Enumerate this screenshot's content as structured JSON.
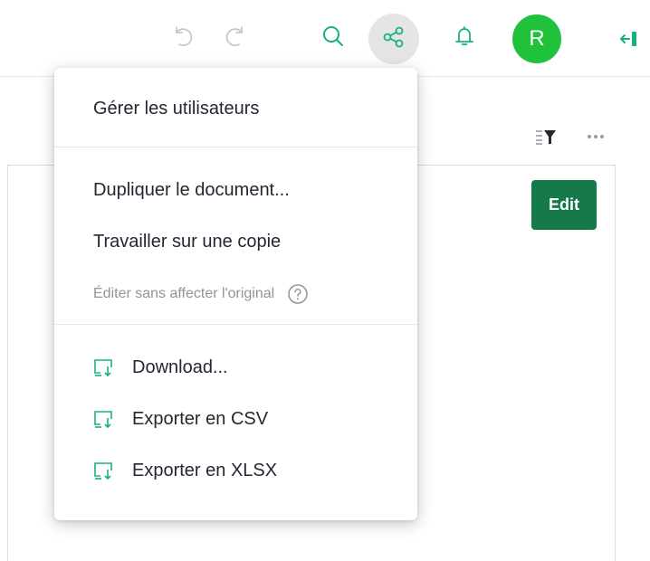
{
  "topbar": {
    "icons": {
      "undo": "undo-icon",
      "redo": "redo-icon",
      "search": "search-icon",
      "share": "share-icon",
      "notifications": "bell-icon",
      "collapse": "collapse-panel-icon"
    },
    "avatar_initial": "R",
    "avatar_color": "#1fc23a",
    "accent_color": "#16b378"
  },
  "widget": {
    "icons": {
      "sort_filter": "sort-filter-icon",
      "more": "more-options-icon"
    },
    "edit_label": "Edit",
    "edit_color": "#16794a"
  },
  "menu": {
    "manage_users": "Gérer les utilisateurs",
    "duplicate": "Dupliquer le document...",
    "work_on_copy": "Travailler sur une copie",
    "edit_note": "Éditer sans affecter l'original",
    "download": "Download...",
    "export_csv": "Exporter en CSV",
    "export_xlsx": "Exporter en XLSX",
    "item_icon": "download-icon",
    "help_icon": "help-circle-icon"
  }
}
